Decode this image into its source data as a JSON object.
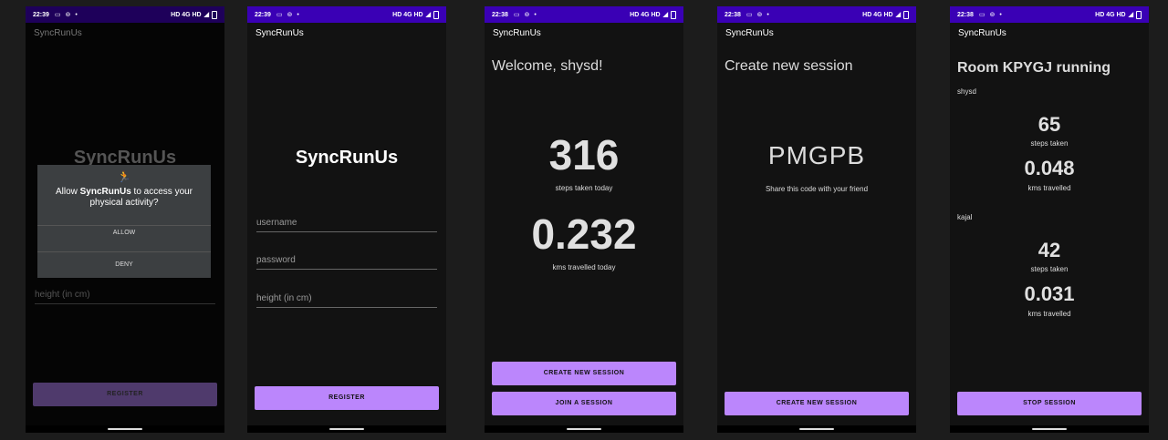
{
  "status": {
    "icons": "HD 4G HD"
  },
  "screens": [
    {
      "time": "22:39",
      "app_title": "SyncRunUs",
      "logo_title": "SyncRunUs",
      "dialog": {
        "message_prefix": "Allow ",
        "app_name": "SyncRunUs",
        "message_suffix": " to access your physical activity?",
        "allow_label": "ALLOW",
        "deny_label": "DENY"
      },
      "height_placeholder": "height (in cm)",
      "register_label": "REGISTER"
    },
    {
      "time": "22:39",
      "app_title": "SyncRunUs",
      "logo_title": "SyncRunUs",
      "username_placeholder": "username",
      "password_placeholder": "password",
      "height_placeholder": "height (in cm)",
      "register_label": "REGISTER"
    },
    {
      "time": "22:38",
      "app_title": "SyncRunUs",
      "welcome": "Welcome, shysd!",
      "steps_value": "316",
      "steps_label": "steps taken today",
      "kms_value": "0.232",
      "kms_label": "kms travelled today",
      "create_label": "CREATE NEW SESSION",
      "join_label": "JOIN A SESSION"
    },
    {
      "time": "22:38",
      "app_title": "SyncRunUs",
      "heading": "Create new session",
      "code": "PMGPB",
      "code_hint": "Share this code with your friend",
      "create_label": "CREATE NEW SESSION"
    },
    {
      "time": "22:38",
      "app_title": "SyncRunUs",
      "room_title": "Room KPYGJ running",
      "users": [
        {
          "name": "shysd",
          "steps": "65",
          "steps_label": "steps taken",
          "kms": "0.048",
          "kms_label": "kms travelled"
        },
        {
          "name": "kajal",
          "steps": "42",
          "steps_label": "steps taken",
          "kms": "0.031",
          "kms_label": "kms travelled"
        }
      ],
      "stop_label": "STOP SESSION"
    }
  ]
}
